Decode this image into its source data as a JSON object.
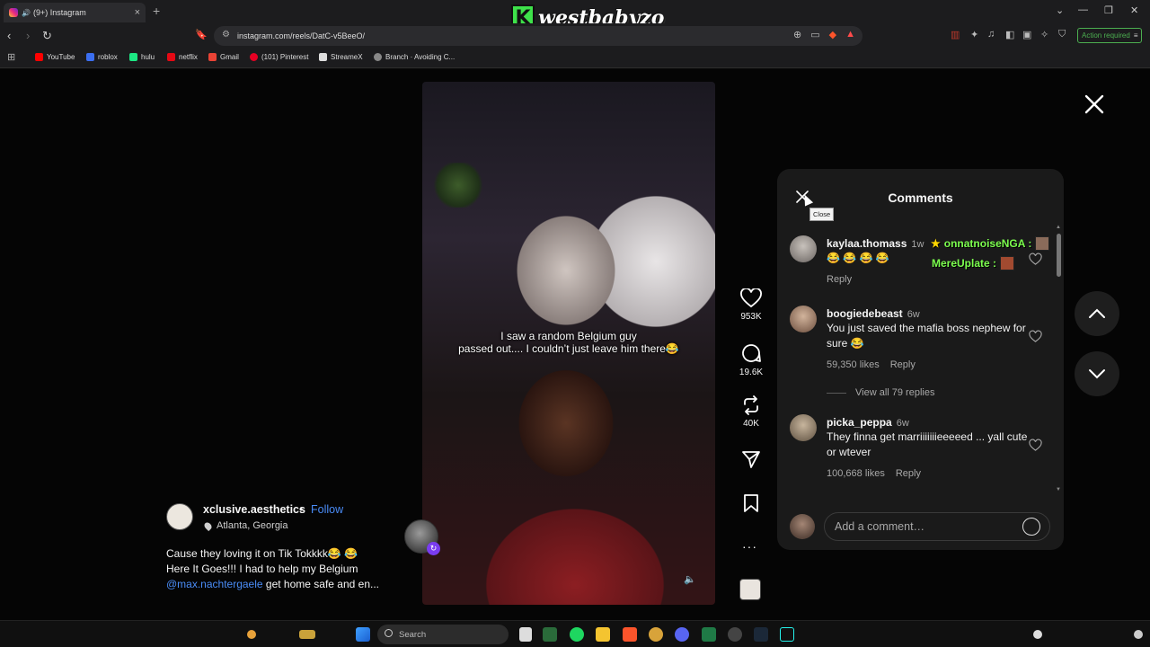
{
  "browser": {
    "tab_title": "(9+) Instagram",
    "url": "instagram.com/reels/DatC-v5BeeO/",
    "action_required": "Action required",
    "bookmarks": [
      {
        "label": "YouTube",
        "color": "#ff0000"
      },
      {
        "label": "roblox",
        "color": "#3b6ef0"
      },
      {
        "label": "hulu",
        "color": "#1ce783"
      },
      {
        "label": "netflix",
        "color": "#e50914"
      },
      {
        "label": "Gmail",
        "color": "#ea4335"
      },
      {
        "label": "(101) Pinterest",
        "color": "#e60023"
      },
      {
        "label": "StreameX",
        "color": "#dddddd"
      },
      {
        "label": "Branch · Avoiding C...",
        "color": "#888888"
      }
    ]
  },
  "watermark": {
    "letter": "K",
    "text": "westbabyzo"
  },
  "reel": {
    "caption_overlay_line1": "I saw a random Belgium guy",
    "caption_overlay_line2": "passed out.... I couldn’t just leave him there😂",
    "likes": "953K",
    "comments": "19.6K",
    "reposts": "40K",
    "more": "···"
  },
  "author": {
    "username": "xclusive.aesthetics",
    "separator": "•",
    "follow_label": "Follow",
    "location": "Atlanta, Georgia",
    "caption_line1": "Cause they loving it on Tik Tokkkk😂 😂",
    "caption_line2": "Here It Goes!!! I had to help my Belgium",
    "mention": "@max.nachtergaele",
    "caption_line3_rest": " get home safe and en..."
  },
  "comments_panel": {
    "title": "Comments",
    "close_tooltip": "Close",
    "overlay_name1": "onnatnoiseNGA :",
    "overlay_name2": "MereUplate :",
    "items": [
      {
        "user": "kaylaa.thomass",
        "time": "1w",
        "text": "😂 😂 😂 😂",
        "likes": "",
        "reply": "Reply",
        "avatar_color": "#8f8a86"
      },
      {
        "user": "boogiedebeast",
        "time": "6w",
        "text": "You just saved the mafia boss nephew for sure 😂",
        "likes": "59,350 likes",
        "reply": "Reply",
        "avatar_color": "#b89780"
      },
      {
        "user": "picka_peppa",
        "time": "6w",
        "text": "They finna get marriiiiiiieeeeed ... yall cute or wtever",
        "likes": "100,668 likes",
        "reply": "Reply",
        "avatar_color": "#9c8a74"
      }
    ],
    "view_replies": "View all 79 replies",
    "add_comment_placeholder": "Add a comment…"
  },
  "taskbar": {
    "search_label": "Search"
  }
}
